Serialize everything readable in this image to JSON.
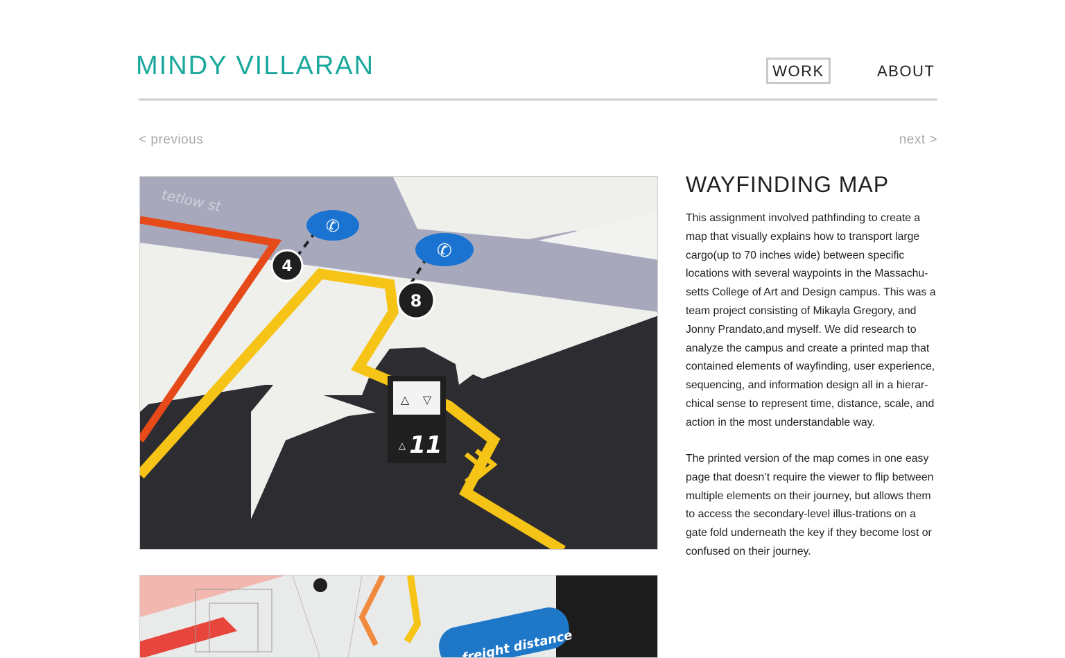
{
  "site": {
    "title": "MINDY VILLARAN",
    "title_color": "#1aa89c"
  },
  "nav": {
    "work_label": "WORK",
    "about_label": "ABOUT",
    "active": "WORK"
  },
  "pager": {
    "previous_label": "< previous",
    "next_label": "next >"
  },
  "project": {
    "title": "WAYFINDING MAP",
    "paragraphs": [
      "This assignment involved pathfinding to create a map that visually explains how to transport large cargo(up to 70 inches wide) between specific locations with several waypoints in the Massachu-setts College of Art and Design campus. This was a team project consisting of Mikayla Gregory, and Jonny Prandato,and myself. We did research to analyze the campus and create a printed map that contained elements of wayfinding, user experience, sequencing, and information design all in a hierar-chical sense to represent time, distance, scale, and action in the most understandable way.",
      "The printed version of the map comes in one easy page that doesn’t require the viewer to flip between multiple elements on their journey, but allows them to access the secondary-level illus-trations on a gate fold underneath the key if they become lost or confused on their journey."
    ]
  },
  "photos": {
    "map_street_label": "tetlow st",
    "waypoints": [
      "4",
      "8"
    ],
    "elevator_floor": "11",
    "detail_label": "freight distance",
    "colors": {
      "route": "#f5c416",
      "secondary_route": "#e64a19",
      "phone_marker": "#1a73d0",
      "street": "#a8a8bd",
      "building": "#2c2c31"
    }
  }
}
